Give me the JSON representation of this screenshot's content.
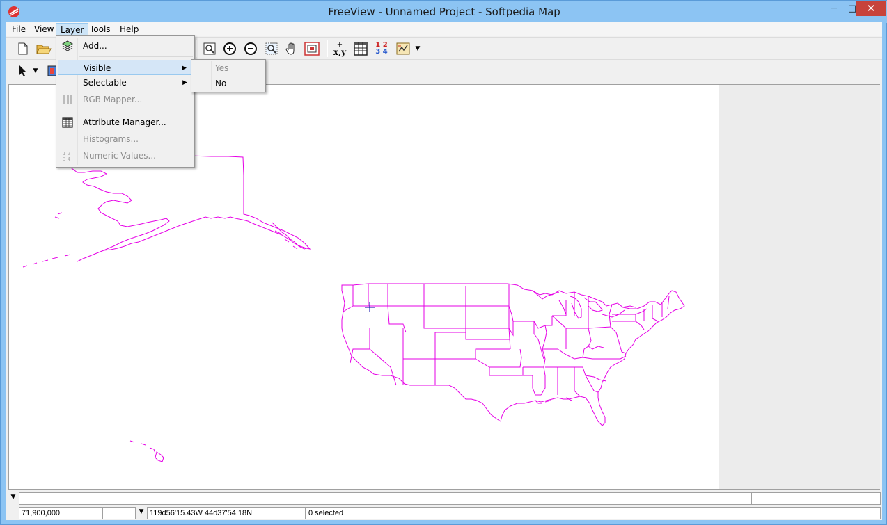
{
  "window": {
    "title": "FreeView - Unnamed Project - Softpedia Map",
    "minimize": "─",
    "maximize": "□",
    "close": "✕"
  },
  "menubar": {
    "items": [
      "File",
      "View",
      "Layer",
      "Tools",
      "Help"
    ],
    "active": "Layer"
  },
  "layer_menu": {
    "items": [
      {
        "label": "Add...",
        "icon": "layers-add-icon",
        "enabled": true
      },
      {
        "label": "Visible",
        "icon": "",
        "enabled": true,
        "submenu": true,
        "highlighted": true
      },
      {
        "label": "Selectable",
        "icon": "",
        "enabled": true,
        "submenu": true
      },
      {
        "label": "RGB Mapper...",
        "icon": "rgb-bars-icon",
        "enabled": false
      },
      {
        "label": "Attribute Manager...",
        "icon": "table-icon",
        "enabled": true
      },
      {
        "label": "Histograms...",
        "icon": "",
        "enabled": false
      },
      {
        "label": "Numeric Values...",
        "icon": "numeric-values-icon",
        "enabled": false
      }
    ]
  },
  "visible_submenu": {
    "items": [
      {
        "label": "Yes",
        "enabled": false
      },
      {
        "label": "No",
        "enabled": true
      }
    ]
  },
  "toolbar": {
    "xy_label": "x,y",
    "numbers_top": "1 2",
    "numbers_bottom": "3 4"
  },
  "status": {
    "scale": "71,900,000",
    "coordinates": "119d56'15.43W  44d37'54.18N",
    "selection": "0 selected"
  },
  "colors": {
    "map_outline": "#e600e6",
    "cursor": "#0000aa",
    "titlebar": "#8cc4f3",
    "close_button": "#c7433b",
    "menu_highlight": "#d5e6f7"
  }
}
